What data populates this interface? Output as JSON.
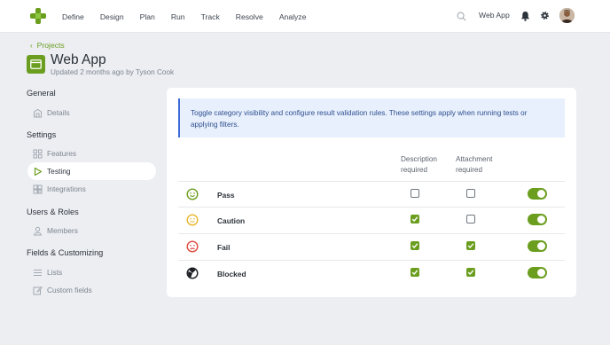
{
  "nav": {
    "items": [
      "Define",
      "Design",
      "Plan",
      "Run",
      "Track",
      "Resolve",
      "Analyze"
    ],
    "project": "Web App"
  },
  "header": {
    "breadcrumb": "Projects",
    "title": "Web App",
    "subtitle": "Updated 2 months ago by Tyson Cook"
  },
  "sidebar": {
    "general": {
      "heading": "General",
      "items": [
        {
          "label": "Details",
          "icon": "building-icon"
        }
      ]
    },
    "settings": {
      "heading": "Settings",
      "items": [
        {
          "label": "Features",
          "icon": "grid-icon"
        },
        {
          "label": "Testing",
          "icon": "play-icon",
          "active": true
        },
        {
          "label": "Integrations",
          "icon": "puzzle-icon"
        }
      ]
    },
    "users": {
      "heading": "Users & Roles",
      "items": [
        {
          "label": "Members",
          "icon": "user-icon"
        }
      ]
    },
    "fields": {
      "heading": "Fields & Customizing",
      "items": [
        {
          "label": "Lists",
          "icon": "list-icon"
        },
        {
          "label": "Custom fields",
          "icon": "edit-icon"
        }
      ]
    }
  },
  "info": "Toggle category visibility and configure result validation rules. These settings apply when running tests or applying filters.",
  "columns": {
    "description": "Description required",
    "attachment": "Attachment required"
  },
  "results": [
    {
      "label": "Pass",
      "description_required": false,
      "attachment_required": false,
      "visible": true,
      "color": "#6b9e1f"
    },
    {
      "label": "Caution",
      "description_required": true,
      "attachment_required": false,
      "visible": true,
      "color": "#e8b62a"
    },
    {
      "label": "Fail",
      "description_required": true,
      "attachment_required": true,
      "visible": true,
      "color": "#e0493d"
    },
    {
      "label": "Blocked",
      "description_required": true,
      "attachment_required": true,
      "visible": true,
      "color": "#1c1f24"
    }
  ],
  "colors": {
    "accent": "#6b9e1f",
    "info_bg": "#e8f0fd",
    "info_border": "#3d6ad6"
  }
}
